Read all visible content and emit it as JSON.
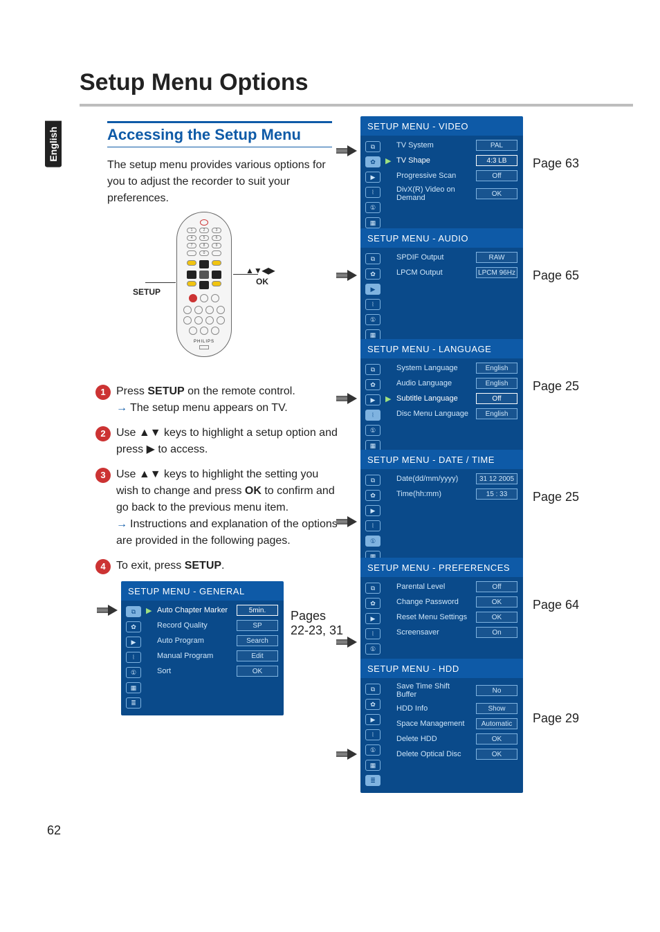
{
  "lang_tab": "English",
  "page_title": "Setup Menu Options",
  "section_heading": "Accessing the Setup Menu",
  "intro_text": "The setup menu provides various options for you to adjust the recorder to suit your preferences.",
  "remote": {
    "setup_label": "SETUP",
    "ok_label": "OK",
    "arrows_label": "▲▼◀▶"
  },
  "steps": {
    "s1_a": "Press ",
    "s1_bold": "SETUP",
    "s1_b": " on the remote control.",
    "s1_sub": "The setup menu appears on TV.",
    "s2": "Use ▲▼ keys to highlight a setup option and press ▶ to access.",
    "s3_a": "Use ▲▼ keys to highlight the setting you wish to change and press ",
    "s3_boldA": "OK",
    "s3_b": " to confirm and go back to the previous menu item.",
    "s3_sub": "Instructions and explanation of the options are provided in the following pages.",
    "s4_a": "To exit, press ",
    "s4_bold": "SETUP",
    "s4_b": "."
  },
  "menus": {
    "general": {
      "title": "SETUP MENU - GENERAL",
      "rows": [
        {
          "label": "Auto Chapter Marker",
          "value": "5min.",
          "sel": true
        },
        {
          "label": "Record Quality",
          "value": "SP"
        },
        {
          "label": "Auto Program",
          "value": "Search"
        },
        {
          "label": "Manual Program",
          "value": "Edit"
        },
        {
          "label": "Sort",
          "value": "OK"
        }
      ],
      "page_ref": "Pages 22-23, 31"
    },
    "video": {
      "title": "SETUP MENU - VIDEO",
      "rows": [
        {
          "label": "TV System",
          "value": "PAL"
        },
        {
          "label": "TV Shape",
          "value": "4:3 LB",
          "sel": true
        },
        {
          "label": "Progressive Scan",
          "value": "Off"
        },
        {
          "label": "DivX(R) Video on Demand",
          "value": "OK"
        }
      ],
      "page_ref": "Page 63"
    },
    "audio": {
      "title": "SETUP MENU - AUDIO",
      "rows": [
        {
          "label": "SPDIF Output",
          "value": "RAW"
        },
        {
          "label": "LPCM Output",
          "value": "LPCM 96Hz"
        }
      ],
      "page_ref": "Page 65"
    },
    "language": {
      "title": "SETUP MENU - LANGUAGE",
      "rows": [
        {
          "label": "System Language",
          "value": "English"
        },
        {
          "label": "Audio Language",
          "value": "English"
        },
        {
          "label": "Subtitle Language",
          "value": "Off",
          "sel": true
        },
        {
          "label": "Disc Menu Language",
          "value": "English"
        }
      ],
      "page_ref": "Page 25"
    },
    "datetime": {
      "title": "SETUP MENU - DATE / TIME",
      "rows": [
        {
          "label": "Date(dd/mm/yyyy)",
          "value": "31 12 2005"
        },
        {
          "label": "Time(hh:mm)",
          "value": "15 : 33"
        }
      ],
      "page_ref": "Page 25"
    },
    "prefs": {
      "title": "SETUP MENU - PREFERENCES",
      "rows": [
        {
          "label": "Parental Level",
          "value": "Off"
        },
        {
          "label": "Change Password",
          "value": "OK"
        },
        {
          "label": "Reset Menu Settings",
          "value": "OK"
        },
        {
          "label": "Screensaver",
          "value": "On"
        }
      ],
      "page_ref": "Page 64"
    },
    "hdd": {
      "title": "SETUP MENU - HDD",
      "rows": [
        {
          "label": "Save Time Shift Buffer",
          "value": "No"
        },
        {
          "label": "HDD Info",
          "value": "Show"
        },
        {
          "label": "Space Management",
          "value": "Automatic"
        },
        {
          "label": "Delete HDD",
          "value": "OK"
        },
        {
          "label": "Delete Optical Disc",
          "value": "OK"
        }
      ],
      "page_ref": "Page 29"
    }
  },
  "page_number": "62"
}
